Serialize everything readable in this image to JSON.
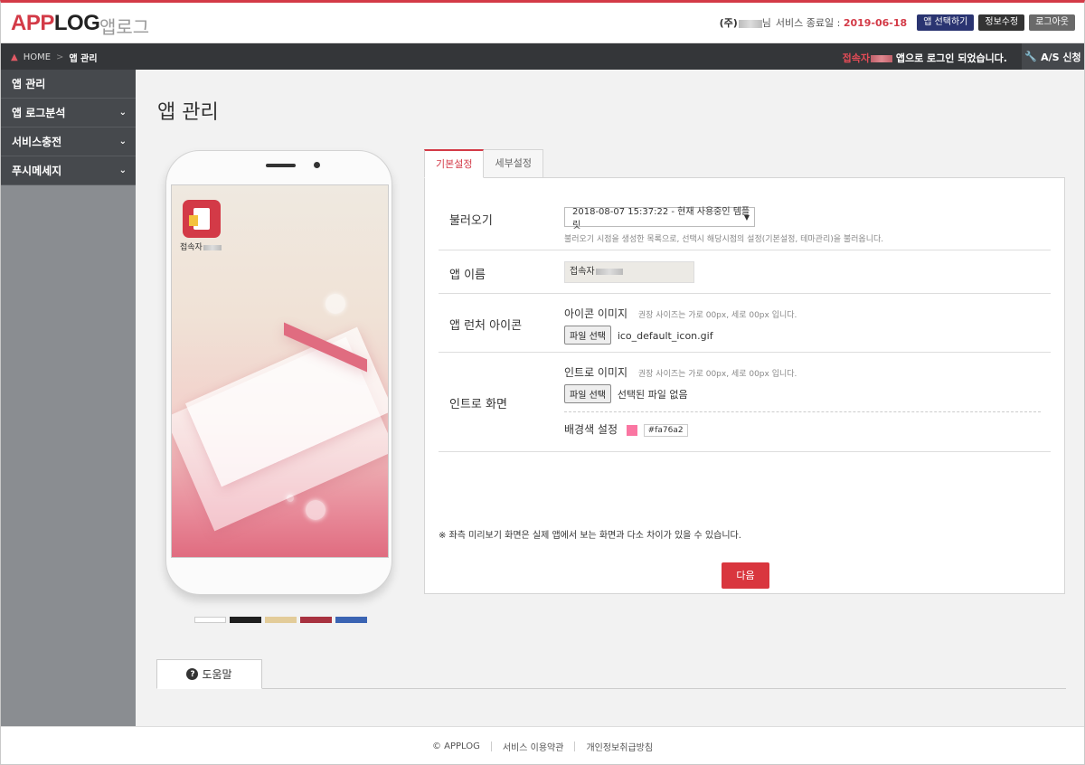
{
  "header": {
    "logo_red": "APP",
    "logo_dark": "LOG",
    "logo_sub": "앱로그",
    "corp_prefix": "(주)",
    "corp_suffix": "님",
    "service_end_label": "서비스 종료일 :",
    "service_end_date": "2019-06-18",
    "btn_select_app": "앱 선택하기",
    "btn_edit_info": "정보수정",
    "btn_logout": "로그아웃"
  },
  "navbar": {
    "home": "HOME",
    "current": "앱 관리",
    "login_user": "접속자",
    "login_msg": "앱으로 로그인 되었습니다.",
    "as_button": "A/S 신청"
  },
  "sidebar": {
    "items": [
      {
        "label": "앱 관리",
        "has_chevron": false
      },
      {
        "label": "앱 로그분석",
        "has_chevron": true
      },
      {
        "label": "서비스충전",
        "has_chevron": true
      },
      {
        "label": "푸시메세지",
        "has_chevron": true
      }
    ]
  },
  "main": {
    "title": "앱 관리",
    "phone": {
      "app_label": "접속자"
    },
    "swatches": [
      "#ffffff",
      "#1f1f1f",
      "#e3cc99",
      "#a83240",
      "#3b64b3"
    ],
    "tabs": [
      {
        "label": "기본설정",
        "active": true
      },
      {
        "label": "세부설정",
        "active": false
      }
    ],
    "form": {
      "load_label": "불러오기",
      "load_select": "2018-08-07 15:37:22 - 현재 사용중인 템플릿",
      "load_hint": "불러오기 시점을 생성한 목록으로, 선택시 해당시점의 설정(기본설정, 테마관리)을 불러옵니다.",
      "app_name_label": "앱 이름",
      "app_name_value": "접속자",
      "launcher_label": "앱 런처 아이콘",
      "icon_image_label": "아이콘 이미지",
      "icon_image_hint": "권장 사이즈는 가로 00px, 세로 00px 입니다.",
      "icon_file_button": "파일 선택",
      "icon_file_name": "ico_default_icon.gif",
      "intro_label": "인트로 화면",
      "intro_image_label": "인트로 이미지",
      "intro_image_hint": "권장 사이즈는 가로 00px, 세로 00px 입니다.",
      "intro_file_button": "파일 선택",
      "intro_file_name": "선택된 파일 없음",
      "bg_color_label": "배경색 설정",
      "bg_color_value": "#fa76a2"
    },
    "notice": "※ 좌측 미리보기 화면은 실제 앱에서 보는 화면과 다소 차이가 있을 수 있습니다.",
    "next_button": "다음",
    "help_tab": "도움말"
  },
  "footer": {
    "copyright": "© APPLOG",
    "terms": "서비스 이용약관",
    "privacy": "개인정보취급방침"
  },
  "colors": {
    "accent": "#d33a47",
    "navbar": "#343639",
    "sidebar": "#46494d"
  },
  "icons": [
    "home-icon",
    "wrench-icon",
    "chevron-down-icon",
    "question-icon",
    "dropdown-arrow-icon"
  ]
}
